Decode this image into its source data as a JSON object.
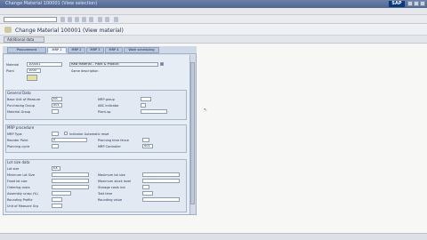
{
  "window": {
    "title": "Change Material 100001 (View selection)",
    "logo": "SAP"
  },
  "app": {
    "title": "Change Material 100001 (View material)",
    "toolbar_button": "Additional data"
  },
  "tabs": [
    {
      "label": "Procurement"
    },
    {
      "label": "MRP 1"
    },
    {
      "label": "MRP 2"
    },
    {
      "label": "MRP 3"
    },
    {
      "label": "MRP 4"
    },
    {
      "label": "Work scheduling"
    }
  ],
  "header": {
    "material_label": "Material",
    "material_value": "100001",
    "material_desc": "Raw Material – Plant & Product",
    "plant_label": "Plant",
    "plant_value": "1000",
    "link_text": "Same description"
  },
  "groups": {
    "general": {
      "title": "General Data",
      "fields": [
        {
          "label": "Base Unit of Measure",
          "value": "EA"
        },
        {
          "label": "Purchasing Group",
          "value": "001"
        },
        {
          "label": "Material-Group",
          "value": ""
        }
      ],
      "right_fields": [
        {
          "label": "MRP group",
          "value": ""
        },
        {
          "label": "ABC indicator",
          "value": ""
        },
        {
          "label": "Plant-sp.",
          "value": ""
        }
      ]
    },
    "mrp": {
      "title": "MRP procedure",
      "fields": [
        {
          "label": "MRP Type",
          "value": ""
        },
        {
          "label": "Reorder Point",
          "value": "0"
        },
        {
          "label": "Planning cycle",
          "value": ""
        }
      ],
      "right_fields": [
        {
          "label": "Indicator Automatic reset",
          "value": ""
        },
        {
          "label": "Planning time fence",
          "value": ""
        },
        {
          "label": "MRP Controller",
          "value": "001"
        }
      ]
    },
    "lot": {
      "title": "Lot size data",
      "fields": [
        {
          "label": "Lot size",
          "value": "EX"
        },
        {
          "label": "Minimum Lot Size",
          "value": ""
        },
        {
          "label": "Fixed lot size",
          "value": ""
        },
        {
          "label": "Ordering costs",
          "value": ""
        },
        {
          "label": "Assembly scrap (%)",
          "value": ""
        },
        {
          "label": "Rounding Profile",
          "value": ""
        },
        {
          "label": "Unit of Measure Grp",
          "value": ""
        }
      ],
      "right_fields": [
        {
          "label": "Maximum lot size",
          "value": ""
        },
        {
          "label": "Maximum stock level",
          "value": ""
        },
        {
          "label": "Storage costs ind.",
          "value": ""
        },
        {
          "label": "Takt time",
          "value": ""
        },
        {
          "label": "Rounding value",
          "value": ""
        }
      ]
    }
  },
  "colors": {
    "titlebar": "#5a6f98",
    "panel": "#dfe7f1",
    "field_border": "#8f9db3"
  }
}
